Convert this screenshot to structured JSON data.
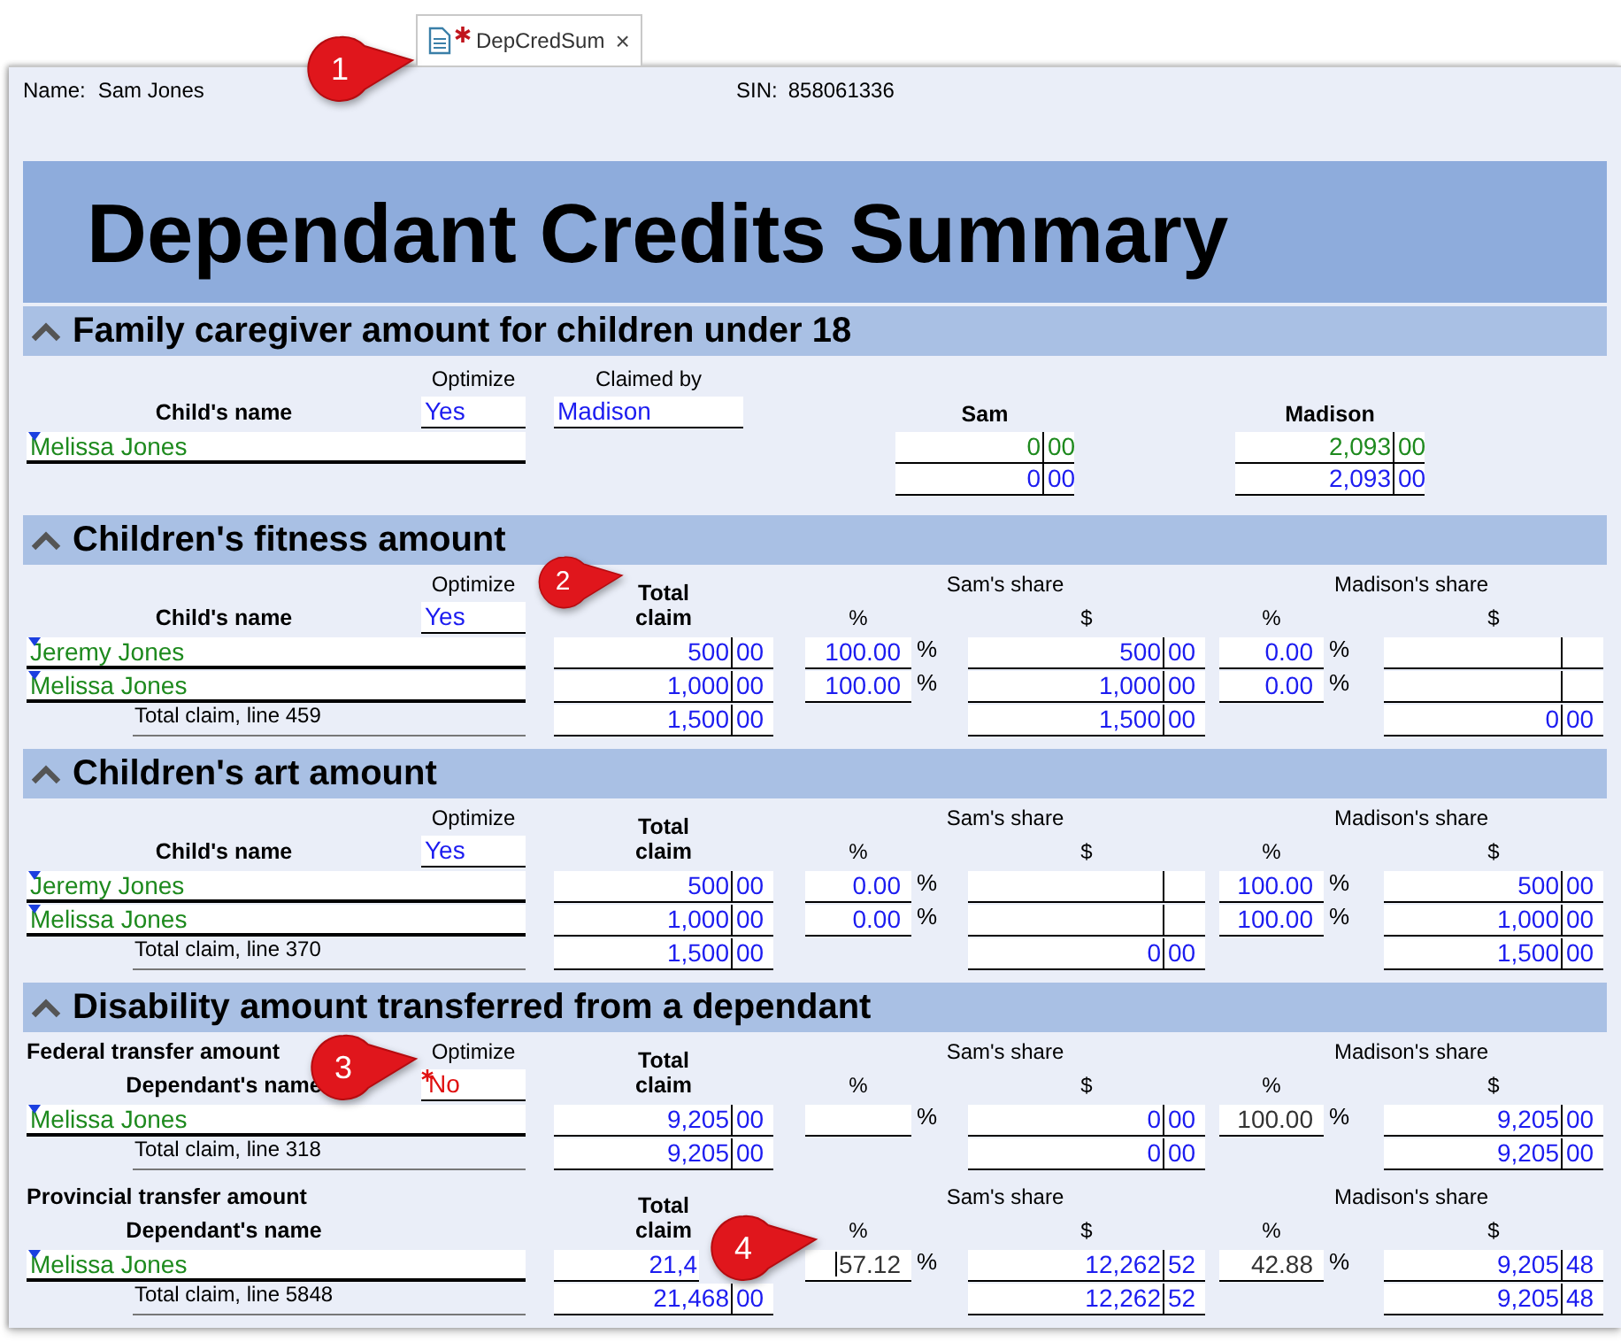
{
  "tab": {
    "label": "DepCredSum",
    "modified": true,
    "close": "×"
  },
  "header": {
    "name_label": "Name:",
    "name": "Sam Jones",
    "sin_label": "SIN:",
    "sin": "858061336"
  },
  "title": "Dependant Credits Summary",
  "sections": [
    {
      "kind": "caregiver",
      "title": "Family caregiver amount for children under 18",
      "expanded": true,
      "name_header": "Child's name",
      "optimize": {
        "label": "Optimize",
        "value": "Yes",
        "required": false
      },
      "claimed_by": {
        "label": "Claimed by",
        "value": "Madison"
      },
      "col_a": "Sam",
      "col_b": "Madison",
      "rows": [
        {
          "name": "Melissa Jones",
          "linked": true,
          "a": {
            "d": "0",
            "c": "00",
            "linked": true
          },
          "b": {
            "d": "2,093",
            "c": "00",
            "linked": true
          }
        },
        {
          "a": {
            "d": "0",
            "c": "00",
            "linked": false
          },
          "b": {
            "d": "2,093",
            "c": "00",
            "linked": false
          }
        }
      ]
    },
    {
      "kind": "shares",
      "title": "Children's fitness amount",
      "expanded": true,
      "parts": [
        {
          "name_header": "Child's name",
          "optimize": {
            "label": "Optimize",
            "value": "Yes",
            "required": false
          },
          "total": "Total claim",
          "sam_share": "Sam's share",
          "sam_pct": "%",
          "sam_amt": "$",
          "mad_share": "Madison's share",
          "mad_pct": "%",
          "mad_amt": "$",
          "rows": [
            {
              "name": "Jeremy Jones",
              "linked": true,
              "total": {
                "d": "500",
                "c": "00"
              },
              "sam_pct": {
                "value": "100.00",
                "unit": "%",
                "locked": false
              },
              "sam_amt": {
                "d": "500",
                "c": "00"
              },
              "mad_pct": {
                "value": "0.00",
                "unit": "%",
                "locked": false
              },
              "mad_amt": null
            },
            {
              "name": "Melissa Jones",
              "linked": true,
              "total": {
                "d": "1,000",
                "c": "00"
              },
              "sam_pct": {
                "value": "100.00",
                "unit": "%",
                "locked": false
              },
              "sam_amt": {
                "d": "1,000",
                "c": "00"
              },
              "mad_pct": {
                "value": "0.00",
                "unit": "%",
                "locked": false
              },
              "mad_amt": null
            }
          ],
          "sum": {
            "label": "Total claim, line 459",
            "total": {
              "d": "1,500",
              "c": "00"
            },
            "sam_amt": {
              "d": "1,500",
              "c": "00"
            },
            "mad_amt": {
              "d": "0",
              "c": "00"
            }
          }
        }
      ]
    },
    {
      "kind": "shares",
      "title": "Children's art amount",
      "expanded": true,
      "parts": [
        {
          "name_header": "Child's name",
          "optimize": {
            "label": "Optimize",
            "value": "Yes",
            "required": false
          },
          "total": "Total claim",
          "sam_share": "Sam's share",
          "sam_pct": "%",
          "sam_amt": "$",
          "mad_share": "Madison's share",
          "mad_pct": "%",
          "mad_amt": "$",
          "rows": [
            {
              "name": "Jeremy Jones",
              "linked": true,
              "total": {
                "d": "500",
                "c": "00"
              },
              "sam_pct": {
                "value": "0.00",
                "unit": "%",
                "locked": false
              },
              "sam_amt": null,
              "mad_pct": {
                "value": "100.00",
                "unit": "%",
                "locked": false
              },
              "mad_amt": {
                "d": "500",
                "c": "00"
              }
            },
            {
              "name": "Melissa Jones",
              "linked": true,
              "total": {
                "d": "1,000",
                "c": "00"
              },
              "sam_pct": {
                "value": "0.00",
                "unit": "%",
                "locked": false
              },
              "sam_amt": null,
              "mad_pct": {
                "value": "100.00",
                "unit": "%",
                "locked": false
              },
              "mad_amt": {
                "d": "1,000",
                "c": "00"
              }
            }
          ],
          "sum": {
            "label": "Total claim, line 370",
            "total": {
              "d": "1,500",
              "c": "00"
            },
            "sam_amt": {
              "d": "0",
              "c": "00"
            },
            "mad_amt": {
              "d": "1,500",
              "c": "00"
            }
          }
        }
      ]
    },
    {
      "kind": "shares",
      "title": "Disability amount transferred from a dependant",
      "expanded": true,
      "parts": [
        {
          "caption": "Federal transfer amount",
          "name_header": "Dependant's name",
          "optimize": {
            "label": "Optimize",
            "value": "No",
            "required": true
          },
          "total": "Total claim",
          "sam_share": "Sam's share",
          "sam_pct": "%",
          "sam_amt": "$",
          "mad_share": "Madison's share",
          "mad_pct": "%",
          "mad_amt": "$",
          "rows": [
            {
              "name": "Melissa Jones",
              "linked": true,
              "total": {
                "d": "9,205",
                "c": "00"
              },
              "sam_pct": {
                "unit": "%"
              },
              "sam_amt": {
                "d": "0",
                "c": "00"
              },
              "mad_pct": {
                "value": "100.00",
                "unit": "%",
                "locked": true
              },
              "mad_amt": {
                "d": "9,205",
                "c": "00"
              }
            }
          ],
          "sum": {
            "label": "Total claim, line 318",
            "total": {
              "d": "9,205",
              "c": "00"
            },
            "sam_amt": {
              "d": "0",
              "c": "00"
            },
            "mad_amt": {
              "d": "9,205",
              "c": "00"
            }
          }
        },
        {
          "caption": "Provincial transfer amount",
          "name_header": "Dependant's name",
          "total": "Total claim",
          "sam_share": "Sam's share",
          "sam_pct": "%",
          "sam_amt": "$",
          "mad_share": "Madison's share",
          "mad_pct": "%",
          "mad_amt": "$",
          "rows": [
            {
              "name": "Melissa Jones",
              "linked": true,
              "total": {
                "d": "21,4",
                "cut": true
              },
              "sam_pct": {
                "value": "57.12",
                "unit": "%",
                "locked": true,
                "focused": true
              },
              "sam_amt": {
                "d": "12,262",
                "c": "52"
              },
              "mad_pct": {
                "value": "42.88",
                "unit": "%",
                "locked": true
              },
              "mad_amt": {
                "d": "9,205",
                "c": "48"
              }
            }
          ],
          "sum": {
            "label": "Total claim, line 5848",
            "total": {
              "d": "21,468",
              "c": "00"
            },
            "sam_amt": {
              "d": "12,262",
              "c": "52"
            },
            "mad_amt": {
              "d": "9,205",
              "c": "48"
            }
          }
        }
      ]
    }
  ],
  "callouts": [
    "1",
    "2",
    "3",
    "4"
  ]
}
